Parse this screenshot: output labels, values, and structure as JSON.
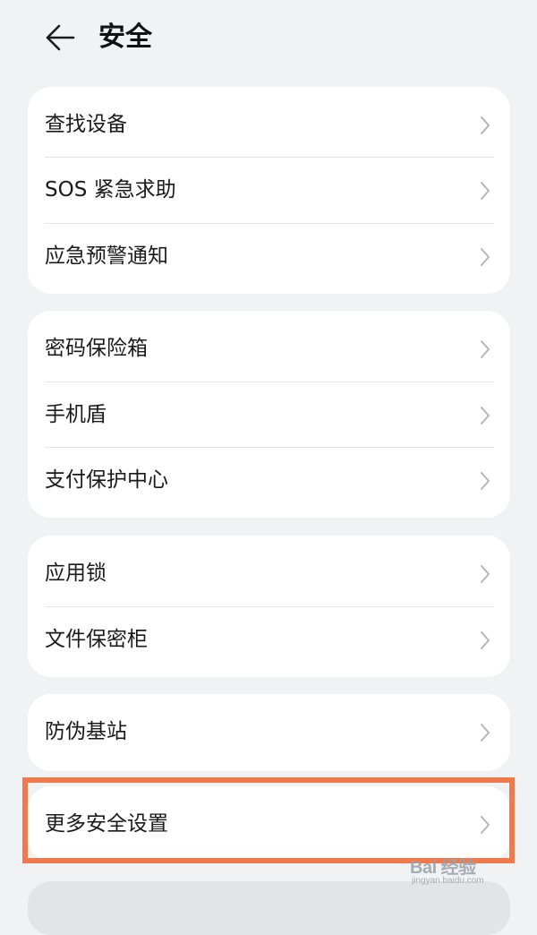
{
  "header": {
    "title": "安全",
    "back_icon": "back-arrow-icon"
  },
  "groups": [
    {
      "items": [
        {
          "label": "查找设备"
        },
        {
          "label": "SOS 紧急求助"
        },
        {
          "label": "应急预警通知"
        }
      ]
    },
    {
      "items": [
        {
          "label": "密码保险箱"
        },
        {
          "label": "手机盾"
        },
        {
          "label": "支付保护中心"
        }
      ]
    },
    {
      "items": [
        {
          "label": "应用锁"
        },
        {
          "label": "文件保密柜"
        }
      ]
    },
    {
      "items": [
        {
          "label": "防伪基站"
        }
      ]
    },
    {
      "items": [
        {
          "label": "更多安全设置",
          "highlighted": true
        }
      ]
    }
  ],
  "watermark": {
    "logo": "Bai 经验",
    "sub": "jingyan.baidu.com"
  },
  "colors": {
    "background": "#f1f2f4",
    "card": "#ffffff",
    "highlight": "#f07a4c"
  }
}
